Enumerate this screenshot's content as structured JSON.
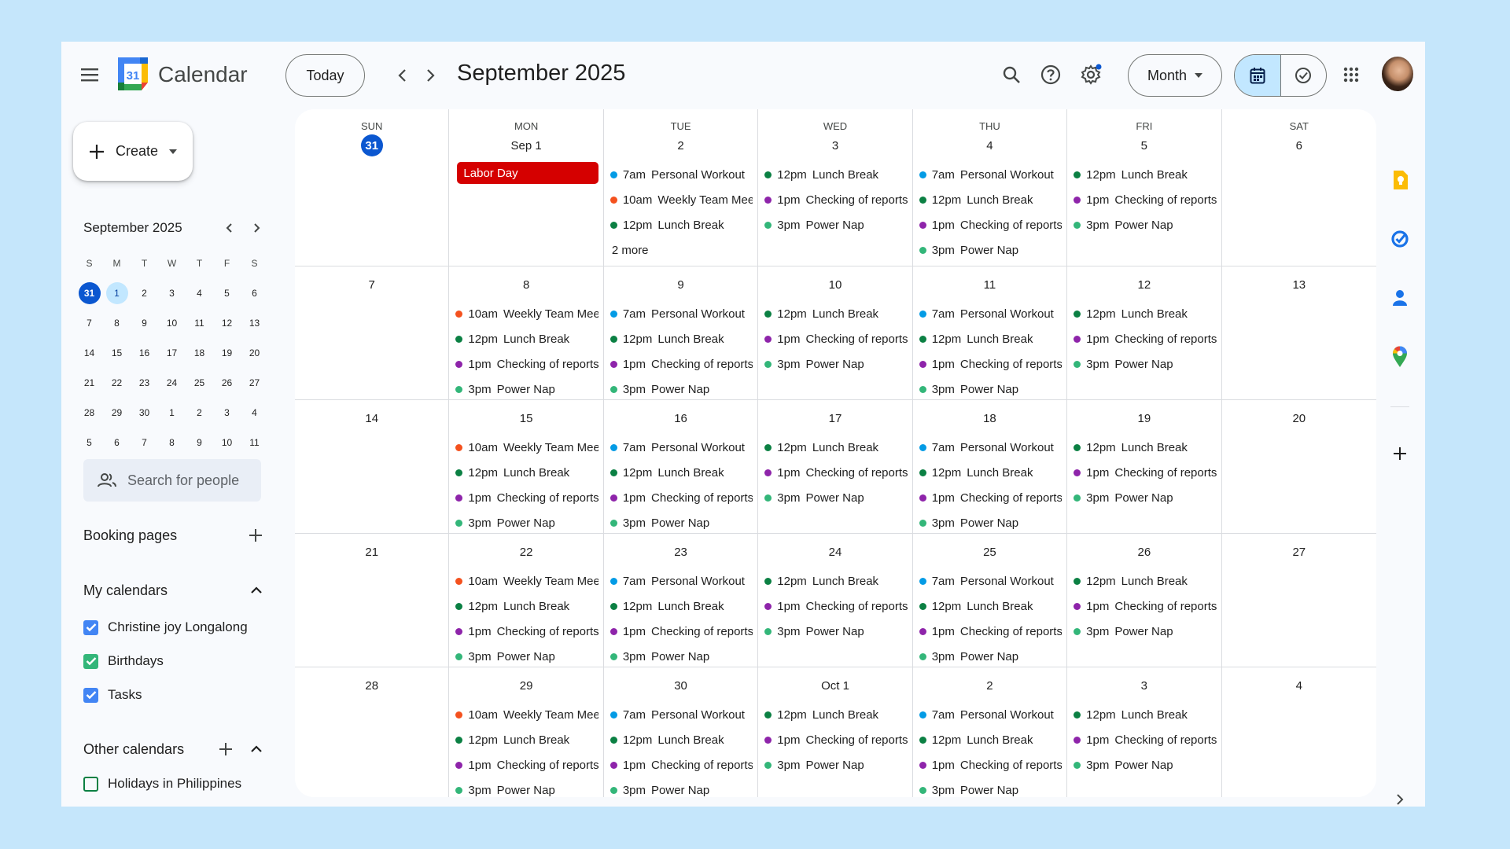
{
  "header": {
    "app_title": "Calendar",
    "logo_text": "31",
    "today_label": "Today",
    "month_title": "September 2025",
    "view_label": "Month"
  },
  "sidebar": {
    "create_label": "Create",
    "mini_calendar": {
      "title": "September 2025",
      "weekdays": [
        "S",
        "M",
        "T",
        "W",
        "T",
        "F",
        "S"
      ],
      "weeks": [
        [
          "31",
          "1",
          "2",
          "3",
          "4",
          "5",
          "6"
        ],
        [
          "7",
          "8",
          "9",
          "10",
          "11",
          "12",
          "13"
        ],
        [
          "14",
          "15",
          "16",
          "17",
          "18",
          "19",
          "20"
        ],
        [
          "21",
          "22",
          "23",
          "24",
          "25",
          "26",
          "27"
        ],
        [
          "28",
          "29",
          "30",
          "1",
          "2",
          "3",
          "4"
        ],
        [
          "5",
          "6",
          "7",
          "8",
          "9",
          "10",
          "11"
        ]
      ]
    },
    "search_placeholder": "Search for people",
    "booking_pages_label": "Booking pages",
    "my_calendars_label": "My calendars",
    "my_calendars": [
      {
        "name": "Christine joy Longalong",
        "color": "#4285f4",
        "checked": true
      },
      {
        "name": "Birthdays",
        "color": "#33b679",
        "checked": true
      },
      {
        "name": "Tasks",
        "color": "#4285f4",
        "checked": true
      }
    ],
    "other_calendars_label": "Other calendars",
    "other_calendars": [
      {
        "name": "Holidays in Philippines",
        "color": "#0b8043",
        "checked": false
      }
    ]
  },
  "colors": {
    "workout": "#039be5",
    "meeting": "#f4511e",
    "lunch": "#0b8043",
    "reports": "#8e24aa",
    "nap": "#33b679",
    "holiday": "#d50000",
    "primary": "#0b57d0"
  },
  "month": {
    "weekday_headers": [
      "SUN",
      "MON",
      "TUE",
      "WED",
      "THU",
      "FRI",
      "SAT"
    ],
    "weeks": [
      [
        {
          "label": "31",
          "today": true,
          "events": []
        },
        {
          "label": "Sep 1",
          "allday": "Labor Day",
          "events": []
        },
        {
          "label": "2",
          "events": [
            {
              "time": "7am",
              "title": "Personal Workout",
              "color": "#039be5"
            },
            {
              "time": "10am",
              "title": "Weekly Team Meeti",
              "color": "#f4511e"
            },
            {
              "time": "12pm",
              "title": "Lunch Break",
              "color": "#0b8043"
            }
          ],
          "more": "2 more"
        },
        {
          "label": "3",
          "events": [
            {
              "time": "12pm",
              "title": "Lunch Break",
              "color": "#0b8043"
            },
            {
              "time": "1pm",
              "title": "Checking of reports",
              "color": "#8e24aa"
            },
            {
              "time": "3pm",
              "title": "Power Nap",
              "color": "#33b679"
            }
          ]
        },
        {
          "label": "4",
          "events": [
            {
              "time": "7am",
              "title": "Personal Workout",
              "color": "#039be5"
            },
            {
              "time": "12pm",
              "title": "Lunch Break",
              "color": "#0b8043"
            },
            {
              "time": "1pm",
              "title": "Checking of reports",
              "color": "#8e24aa"
            },
            {
              "time": "3pm",
              "title": "Power Nap",
              "color": "#33b679"
            }
          ]
        },
        {
          "label": "5",
          "events": [
            {
              "time": "12pm",
              "title": "Lunch Break",
              "color": "#0b8043"
            },
            {
              "time": "1pm",
              "title": "Checking of reports",
              "color": "#8e24aa"
            },
            {
              "time": "3pm",
              "title": "Power Nap",
              "color": "#33b679"
            }
          ]
        },
        {
          "label": "6",
          "events": []
        }
      ],
      [
        {
          "label": "7",
          "events": []
        },
        {
          "label": "8",
          "events": [
            {
              "time": "10am",
              "title": "Weekly Team Meeti",
              "color": "#f4511e"
            },
            {
              "time": "12pm",
              "title": "Lunch Break",
              "color": "#0b8043"
            },
            {
              "time": "1pm",
              "title": "Checking of reports",
              "color": "#8e24aa"
            },
            {
              "time": "3pm",
              "title": "Power Nap",
              "color": "#33b679"
            }
          ]
        },
        {
          "label": "9",
          "events": [
            {
              "time": "7am",
              "title": "Personal Workout",
              "color": "#039be5"
            },
            {
              "time": "12pm",
              "title": "Lunch Break",
              "color": "#0b8043"
            },
            {
              "time": "1pm",
              "title": "Checking of reports",
              "color": "#8e24aa"
            },
            {
              "time": "3pm",
              "title": "Power Nap",
              "color": "#33b679"
            }
          ]
        },
        {
          "label": "10",
          "events": [
            {
              "time": "12pm",
              "title": "Lunch Break",
              "color": "#0b8043"
            },
            {
              "time": "1pm",
              "title": "Checking of reports",
              "color": "#8e24aa"
            },
            {
              "time": "3pm",
              "title": "Power Nap",
              "color": "#33b679"
            }
          ]
        },
        {
          "label": "11",
          "events": [
            {
              "time": "7am",
              "title": "Personal Workout",
              "color": "#039be5"
            },
            {
              "time": "12pm",
              "title": "Lunch Break",
              "color": "#0b8043"
            },
            {
              "time": "1pm",
              "title": "Checking of reports",
              "color": "#8e24aa"
            },
            {
              "time": "3pm",
              "title": "Power Nap",
              "color": "#33b679"
            }
          ]
        },
        {
          "label": "12",
          "events": [
            {
              "time": "12pm",
              "title": "Lunch Break",
              "color": "#0b8043"
            },
            {
              "time": "1pm",
              "title": "Checking of reports",
              "color": "#8e24aa"
            },
            {
              "time": "3pm",
              "title": "Power Nap",
              "color": "#33b679"
            }
          ]
        },
        {
          "label": "13",
          "events": []
        }
      ],
      [
        {
          "label": "14",
          "events": []
        },
        {
          "label": "15",
          "events": [
            {
              "time": "10am",
              "title": "Weekly Team Meeti",
              "color": "#f4511e"
            },
            {
              "time": "12pm",
              "title": "Lunch Break",
              "color": "#0b8043"
            },
            {
              "time": "1pm",
              "title": "Checking of reports",
              "color": "#8e24aa"
            },
            {
              "time": "3pm",
              "title": "Power Nap",
              "color": "#33b679"
            }
          ]
        },
        {
          "label": "16",
          "events": [
            {
              "time": "7am",
              "title": "Personal Workout",
              "color": "#039be5"
            },
            {
              "time": "12pm",
              "title": "Lunch Break",
              "color": "#0b8043"
            },
            {
              "time": "1pm",
              "title": "Checking of reports",
              "color": "#8e24aa"
            },
            {
              "time": "3pm",
              "title": "Power Nap",
              "color": "#33b679"
            }
          ]
        },
        {
          "label": "17",
          "events": [
            {
              "time": "12pm",
              "title": "Lunch Break",
              "color": "#0b8043"
            },
            {
              "time": "1pm",
              "title": "Checking of reports",
              "color": "#8e24aa"
            },
            {
              "time": "3pm",
              "title": "Power Nap",
              "color": "#33b679"
            }
          ]
        },
        {
          "label": "18",
          "events": [
            {
              "time": "7am",
              "title": "Personal Workout",
              "color": "#039be5"
            },
            {
              "time": "12pm",
              "title": "Lunch Break",
              "color": "#0b8043"
            },
            {
              "time": "1pm",
              "title": "Checking of reports",
              "color": "#8e24aa"
            },
            {
              "time": "3pm",
              "title": "Power Nap",
              "color": "#33b679"
            }
          ]
        },
        {
          "label": "19",
          "events": [
            {
              "time": "12pm",
              "title": "Lunch Break",
              "color": "#0b8043"
            },
            {
              "time": "1pm",
              "title": "Checking of reports",
              "color": "#8e24aa"
            },
            {
              "time": "3pm",
              "title": "Power Nap",
              "color": "#33b679"
            }
          ]
        },
        {
          "label": "20",
          "events": []
        }
      ],
      [
        {
          "label": "21",
          "events": []
        },
        {
          "label": "22",
          "events": [
            {
              "time": "10am",
              "title": "Weekly Team Meeti",
              "color": "#f4511e"
            },
            {
              "time": "12pm",
              "title": "Lunch Break",
              "color": "#0b8043"
            },
            {
              "time": "1pm",
              "title": "Checking of reports",
              "color": "#8e24aa"
            },
            {
              "time": "3pm",
              "title": "Power Nap",
              "color": "#33b679"
            }
          ]
        },
        {
          "label": "23",
          "events": [
            {
              "time": "7am",
              "title": "Personal Workout",
              "color": "#039be5"
            },
            {
              "time": "12pm",
              "title": "Lunch Break",
              "color": "#0b8043"
            },
            {
              "time": "1pm",
              "title": "Checking of reports",
              "color": "#8e24aa"
            },
            {
              "time": "3pm",
              "title": "Power Nap",
              "color": "#33b679"
            }
          ]
        },
        {
          "label": "24",
          "events": [
            {
              "time": "12pm",
              "title": "Lunch Break",
              "color": "#0b8043"
            },
            {
              "time": "1pm",
              "title": "Checking of reports",
              "color": "#8e24aa"
            },
            {
              "time": "3pm",
              "title": "Power Nap",
              "color": "#33b679"
            }
          ]
        },
        {
          "label": "25",
          "events": [
            {
              "time": "7am",
              "title": "Personal Workout",
              "color": "#039be5"
            },
            {
              "time": "12pm",
              "title": "Lunch Break",
              "color": "#0b8043"
            },
            {
              "time": "1pm",
              "title": "Checking of reports",
              "color": "#8e24aa"
            },
            {
              "time": "3pm",
              "title": "Power Nap",
              "color": "#33b679"
            }
          ]
        },
        {
          "label": "26",
          "events": [
            {
              "time": "12pm",
              "title": "Lunch Break",
              "color": "#0b8043"
            },
            {
              "time": "1pm",
              "title": "Checking of reports",
              "color": "#8e24aa"
            },
            {
              "time": "3pm",
              "title": "Power Nap",
              "color": "#33b679"
            }
          ]
        },
        {
          "label": "27",
          "events": []
        }
      ],
      [
        {
          "label": "28",
          "events": []
        },
        {
          "label": "29",
          "events": [
            {
              "time": "10am",
              "title": "Weekly Team Meeti",
              "color": "#f4511e"
            },
            {
              "time": "12pm",
              "title": "Lunch Break",
              "color": "#0b8043"
            },
            {
              "time": "1pm",
              "title": "Checking of reports",
              "color": "#8e24aa"
            },
            {
              "time": "3pm",
              "title": "Power Nap",
              "color": "#33b679"
            }
          ]
        },
        {
          "label": "30",
          "events": [
            {
              "time": "7am",
              "title": "Personal Workout",
              "color": "#039be5"
            },
            {
              "time": "12pm",
              "title": "Lunch Break",
              "color": "#0b8043"
            },
            {
              "time": "1pm",
              "title": "Checking of reports",
              "color": "#8e24aa"
            },
            {
              "time": "3pm",
              "title": "Power Nap",
              "color": "#33b679"
            }
          ]
        },
        {
          "label": "Oct 1",
          "events": [
            {
              "time": "12pm",
              "title": "Lunch Break",
              "color": "#0b8043"
            },
            {
              "time": "1pm",
              "title": "Checking of reports",
              "color": "#8e24aa"
            },
            {
              "time": "3pm",
              "title": "Power Nap",
              "color": "#33b679"
            }
          ]
        },
        {
          "label": "2",
          "events": [
            {
              "time": "7am",
              "title": "Personal Workout",
              "color": "#039be5"
            },
            {
              "time": "12pm",
              "title": "Lunch Break",
              "color": "#0b8043"
            },
            {
              "time": "1pm",
              "title": "Checking of reports",
              "color": "#8e24aa"
            },
            {
              "time": "3pm",
              "title": "Power Nap",
              "color": "#33b679"
            }
          ]
        },
        {
          "label": "3",
          "events": [
            {
              "time": "12pm",
              "title": "Lunch Break",
              "color": "#0b8043"
            },
            {
              "time": "1pm",
              "title": "Checking of reports",
              "color": "#8e24aa"
            },
            {
              "time": "3pm",
              "title": "Power Nap",
              "color": "#33b679"
            }
          ]
        },
        {
          "label": "4",
          "events": []
        }
      ]
    ]
  },
  "right_rail": {
    "icons": [
      "keep-icon",
      "tasks-icon",
      "contacts-icon",
      "maps-icon"
    ]
  }
}
